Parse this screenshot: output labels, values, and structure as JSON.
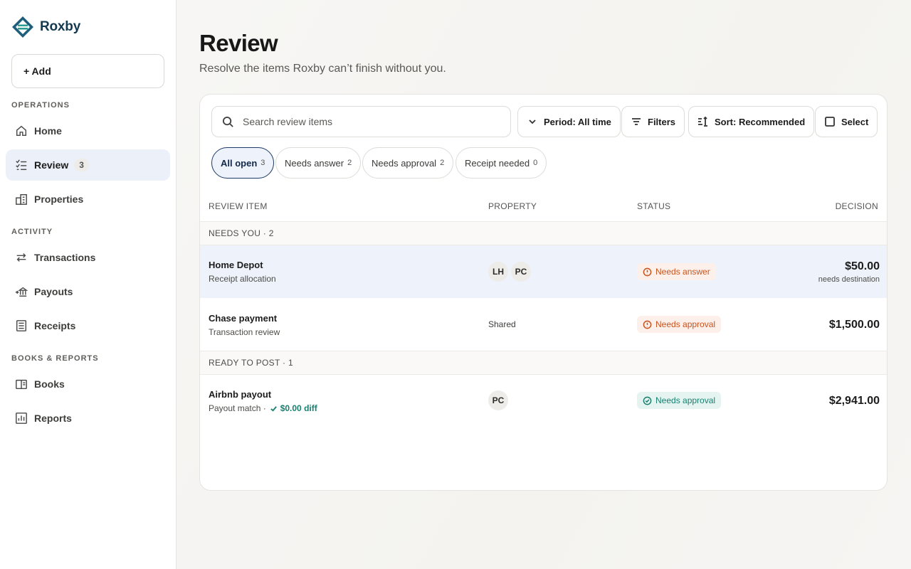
{
  "brand": {
    "name": "Roxby"
  },
  "sidebar": {
    "add_label": "+ Add",
    "sections": [
      {
        "label": "OPERATIONS"
      },
      {
        "label": "ACTIVITY"
      },
      {
        "label": "BOOKS & REPORTS"
      }
    ],
    "items": [
      {
        "label": "Home",
        "icon": "home-icon"
      },
      {
        "label": "Review",
        "icon": "checklist-icon",
        "count": "3",
        "active": true
      },
      {
        "label": "Properties",
        "icon": "buildings-icon"
      },
      {
        "label": "Transactions",
        "icon": "arrows-exchange-icon"
      },
      {
        "label": "Payouts",
        "icon": "bank-icon"
      },
      {
        "label": "Receipts",
        "icon": "receipt-icon"
      },
      {
        "label": "Books",
        "icon": "book-icon"
      },
      {
        "label": "Reports",
        "icon": "report-chart-icon"
      }
    ]
  },
  "header": {
    "title": "Review",
    "subtitle": "Resolve the items Roxby can’t finish without you."
  },
  "toolbar": {
    "search_placeholder": "Search review items",
    "period_label": "Period: All time",
    "filters_label": "Filters",
    "sort_label": "Sort: Recommended",
    "select_label": "Select"
  },
  "tabs": [
    {
      "label": "All open",
      "count": "3",
      "active": true
    },
    {
      "label": "Needs answer",
      "count": "2"
    },
    {
      "label": "Needs approval",
      "count": "2"
    },
    {
      "label": "Receipt needed",
      "count": "0"
    }
  ],
  "table": {
    "columns": [
      "REVIEW ITEM",
      "PROPERTY",
      "STATUS",
      "DECISION"
    ],
    "groups": [
      {
        "label": "NEEDS YOU · 2"
      },
      {
        "label": "READY TO POST · 1"
      }
    ],
    "rows": [
      {
        "title": "Home Depot",
        "subtitle": "Receipt allocation",
        "avatars": [
          "LH",
          "PC"
        ],
        "status": "Needs answer",
        "amount": "$50.00",
        "amount_note": "needs destination"
      },
      {
        "title": "Chase payment",
        "subtitle": "Transaction review",
        "property": "Shared",
        "status": "Needs approval",
        "amount": "$1,500.00"
      },
      {
        "title": "Airbnb payout",
        "subtitle": "Payout match ·",
        "diff": "$0.00 diff",
        "avatars": [
          "PC"
        ],
        "status": "Needs approval",
        "amount": "$2,941.00"
      }
    ]
  },
  "colors": {
    "brand": "#143a52",
    "accent_teal": "#17806f",
    "warning": "#c8531c",
    "active_nav": "#ecf0f8"
  }
}
